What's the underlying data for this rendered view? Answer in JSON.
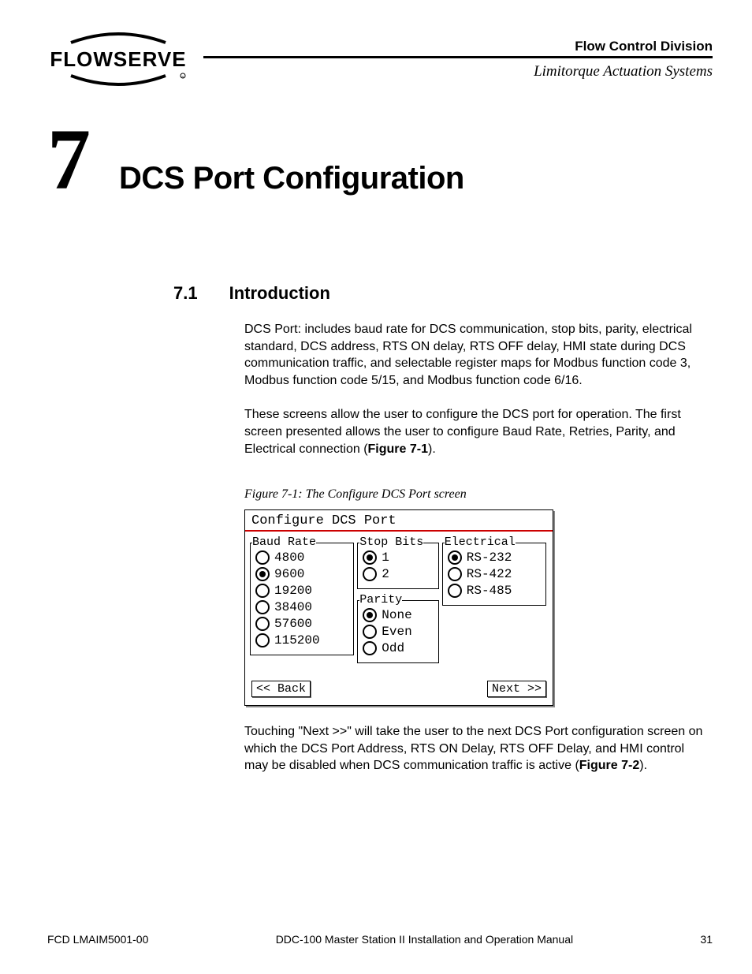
{
  "header": {
    "division": "Flow Control Division",
    "subbrand": "Limitorque Actuation Systems",
    "logo_text": "FLOWSERVE"
  },
  "chapter": {
    "number": "7",
    "title": "DCS Port Configuration"
  },
  "section": {
    "number": "7.1",
    "title": "Introduction"
  },
  "paragraphs": {
    "p1": "DCS Port: includes baud rate for DCS communication, stop bits, parity, electrical standard, DCS address, RTS ON delay, RTS OFF delay, HMI state during DCS communication traffic, and selectable register maps for Modbus function code 3, Modbus function code 5/15, and Modbus function code 6/16.",
    "p2_a": "These screens allow the user to configure the DCS port for operation. The first screen presented allows the user to configure Baud Rate, Retries, Parity, and Electrical connection (",
    "p2_b": "Figure 7-1",
    "p2_c": ").",
    "p3_a": "Touching \"Next >>\" will take the user to the next DCS Port configuration screen on which the DCS Port Address, RTS ON Delay, RTS OFF Delay, and HMI control may be disabled when DCS communication traffic is active (",
    "p3_b": "Figure 7-2",
    "p3_c": ")."
  },
  "figure": {
    "caption": "Figure 7-1: The Configure DCS Port screen",
    "screen_title": "Configure DCS Port",
    "groups": {
      "baud": {
        "label": "Baud Rate",
        "options": [
          "4800",
          "9600",
          "19200",
          "38400",
          "57600",
          "115200"
        ],
        "selected": "9600"
      },
      "stop": {
        "label": "Stop Bits",
        "options": [
          "1",
          "2"
        ],
        "selected": "1"
      },
      "parity": {
        "label": "Parity",
        "options": [
          "None",
          "Even",
          "Odd"
        ],
        "selected": "None"
      },
      "electrical": {
        "label": "Electrical",
        "options": [
          "RS-232",
          "RS-422",
          "RS-485"
        ],
        "selected": "RS-232"
      }
    },
    "back_label": "<< Back",
    "next_label": "Next >>"
  },
  "footer": {
    "left": "FCD LMAIM5001-00",
    "center": "DDC-100 Master Station II Installation and Operation Manual",
    "right": "31"
  }
}
